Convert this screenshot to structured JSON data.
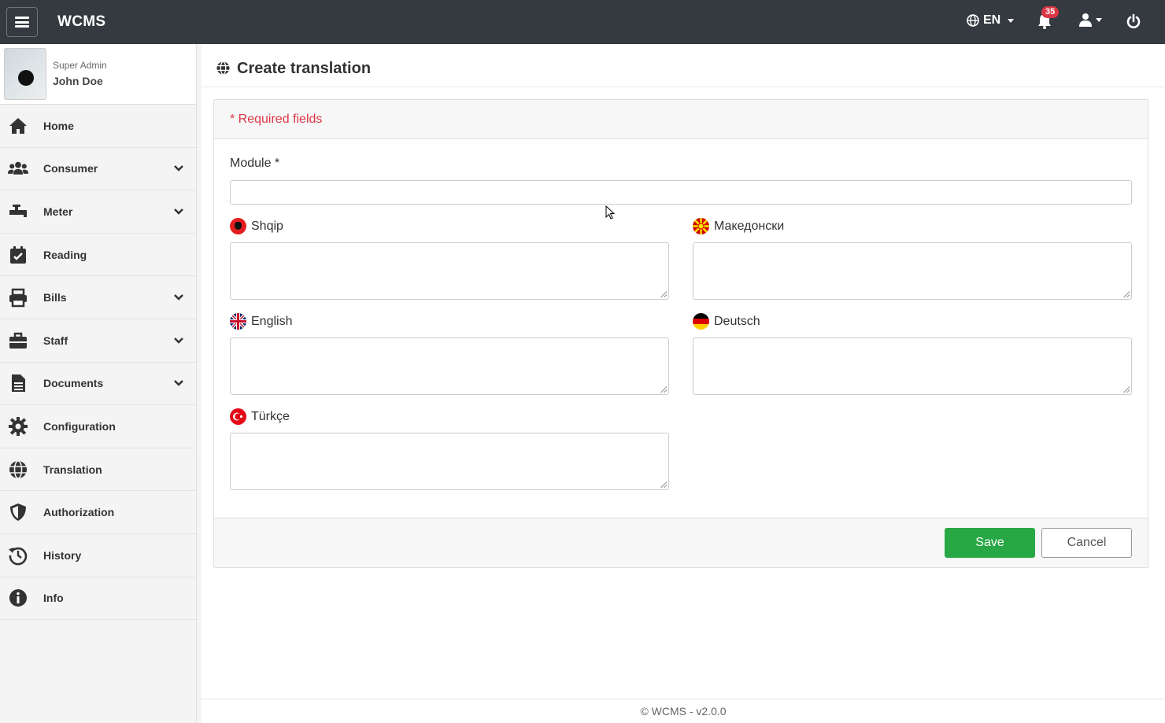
{
  "app": {
    "brand": "WCMS",
    "language": "EN",
    "notification_count": "35"
  },
  "user": {
    "role": "Super Admin",
    "name": "John Doe"
  },
  "sidebar": {
    "items": [
      {
        "label": "Home",
        "icon": "home-icon",
        "has_children": false
      },
      {
        "label": "Consumer",
        "icon": "users-icon",
        "has_children": true
      },
      {
        "label": "Meter",
        "icon": "faucet-icon",
        "has_children": true
      },
      {
        "label": "Reading",
        "icon": "calendar-check-icon",
        "has_children": false
      },
      {
        "label": "Bills",
        "icon": "printer-icon",
        "has_children": true
      },
      {
        "label": "Staff",
        "icon": "briefcase-icon",
        "has_children": true
      },
      {
        "label": "Documents",
        "icon": "document-icon",
        "has_children": true
      },
      {
        "label": "Configuration",
        "icon": "gear-icon",
        "has_children": false
      },
      {
        "label": "Translation",
        "icon": "globe-icon",
        "has_children": false
      },
      {
        "label": "Authorization",
        "icon": "shield-icon",
        "has_children": false
      },
      {
        "label": "History",
        "icon": "history-icon",
        "has_children": false
      },
      {
        "label": "Info",
        "icon": "info-icon",
        "has_children": false
      }
    ]
  },
  "page": {
    "title": "Create translation",
    "required_note": "* Required fields"
  },
  "form": {
    "module": {
      "label": "Module *",
      "value": ""
    },
    "fields": [
      {
        "label": "Shqip",
        "flag": "albania-flag-icon",
        "value": ""
      },
      {
        "label": "Македонски",
        "flag": "macedonia-flag-icon",
        "value": ""
      },
      {
        "label": "English",
        "flag": "uk-flag-icon",
        "value": ""
      },
      {
        "label": "Deutsch",
        "flag": "germany-flag-icon",
        "value": ""
      },
      {
        "label": "Türkçe",
        "flag": "turkey-flag-icon",
        "value": ""
      }
    ],
    "save_label": "Save",
    "cancel_label": "Cancel"
  },
  "footer": {
    "text": "© WCMS - v2.0.0"
  },
  "colors": {
    "topbar": "#343a40",
    "save": "#28a745",
    "badge": "#dc3545",
    "required": "#dc3545"
  }
}
